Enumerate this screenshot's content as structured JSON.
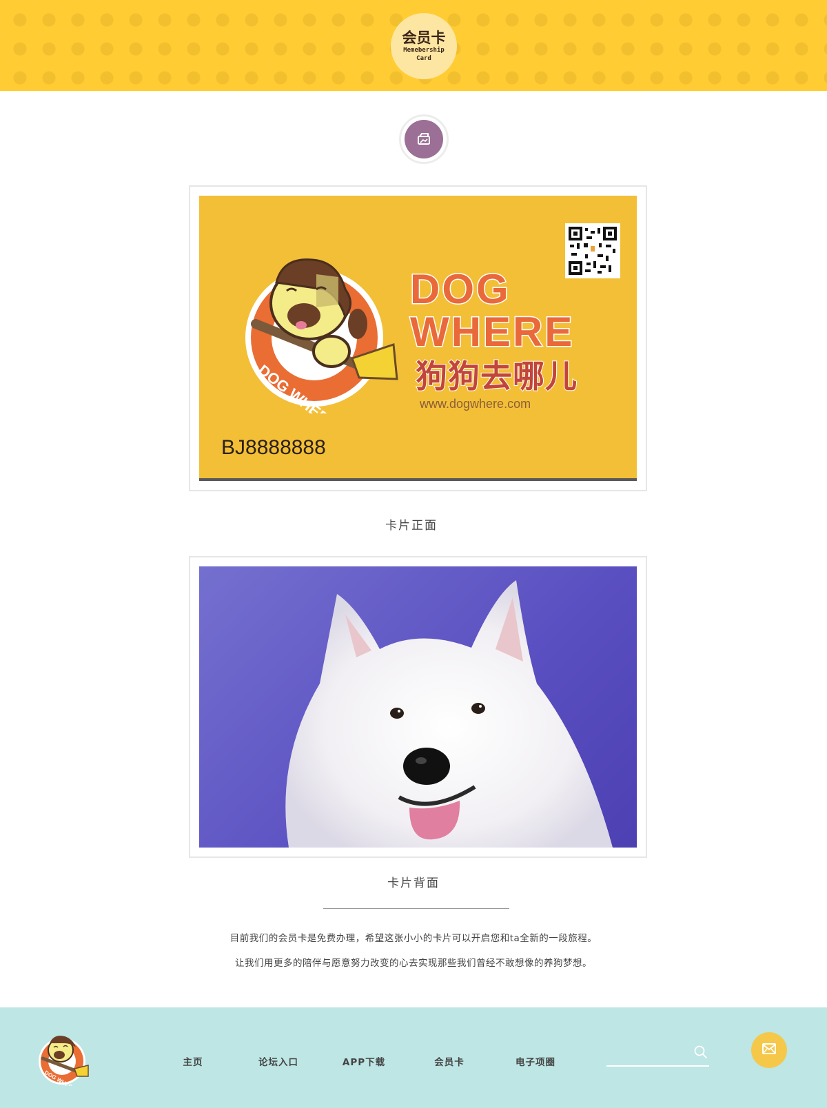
{
  "header": {
    "badge_title": "会员卡",
    "badge_subtitle": "Memebership Card"
  },
  "section_icon": "image-gallery-icon",
  "card_front": {
    "brand_line1": "DOG",
    "brand_line2": "WHERE",
    "brand_chinese": "狗狗去哪儿",
    "brand_url": "www.dogwhere.com",
    "logo_ring_text": "DOG WHERE·",
    "card_number": "BJ8888888",
    "caption": "卡片正面"
  },
  "card_back": {
    "caption": "卡片背面"
  },
  "description": {
    "line1": "目前我们的会员卡是免费办理，希望这张小小的卡片可以开启您和ta全新的一段旅程。",
    "line2": "让我们用更多的陪伴与愿意努力改变的心去实现那些我们曾经不敢想像的养狗梦想。"
  },
  "footer": {
    "logo_text": "DOG WHERE·",
    "nav": [
      "主页",
      "论坛入口",
      "APP下载",
      "会员卡",
      "电子项圈"
    ],
    "search_placeholder": ""
  },
  "colors": {
    "header_yellow": "#ffcc33",
    "card_yellow": "#f3bf36",
    "brand_orange": "#e9693a",
    "icon_purple": "#9b6f96",
    "footer_teal": "#bde6e4",
    "mail_button": "#f5c84a"
  }
}
